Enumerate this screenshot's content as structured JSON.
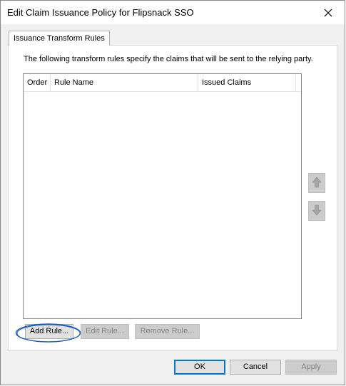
{
  "window": {
    "title": "Edit Claim Issuance Policy for Flipsnack SSO",
    "close_icon": "close-icon"
  },
  "tabs": [
    {
      "label": "Issuance Transform Rules",
      "selected": true
    }
  ],
  "panel": {
    "description": "The following transform rules specify the claims that will be sent to the relying party.",
    "table": {
      "columns": [
        "Order",
        "Rule Name",
        "Issued Claims"
      ],
      "rows": []
    },
    "move_up_icon": "arrow-up-icon",
    "move_down_icon": "arrow-down-icon",
    "buttons": {
      "add_rule": "Add Rule...",
      "edit_rule": "Edit Rule...",
      "remove_rule": "Remove Rule..."
    }
  },
  "footer": {
    "ok": "OK",
    "cancel": "Cancel",
    "apply": "Apply"
  },
  "colors": {
    "highlight_annotation": "#1f5fbf",
    "default_button_border": "#0078d7",
    "disabled_text": "#838383"
  }
}
